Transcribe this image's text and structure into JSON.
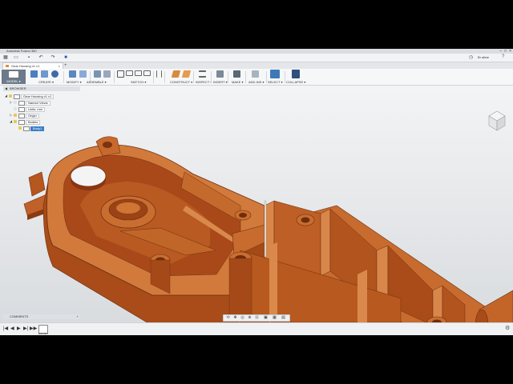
{
  "app": {
    "title": "Autodesk Fusion 360",
    "account": "Br attoe",
    "window_controls": [
      "–",
      "□",
      "×"
    ]
  },
  "qat": {
    "grid_icon": "grid-icon",
    "file_icon": "file-icon",
    "save_icon": "save-icon",
    "undo_icon": "undo-icon",
    "redo_icon": "redo-icon",
    "stop_icon": "stop-icon"
  },
  "document_tab": {
    "label": "Gear Housing v1 v1",
    "close": "×",
    "new_tab": "+"
  },
  "toolbar": {
    "workspace": "MODEL ▾",
    "groups": [
      {
        "label": "CREATE ▾"
      },
      {
        "label": "MODIFY ▾"
      },
      {
        "label": "ASSEMBLE ▾"
      },
      {
        "label": "SKETCH ▾"
      },
      {
        "label": "CONSTRUCT ▾"
      },
      {
        "label": "INSPECT ▾"
      },
      {
        "label": "INSERT ▾"
      },
      {
        "label": "MAKE ▾"
      },
      {
        "label": "ADD-INS ▾"
      },
      {
        "label": "SELECT ▾"
      },
      {
        "label": "COLLAPSE ▾"
      }
    ]
  },
  "browser": {
    "title": "BROWSER",
    "nodes": [
      {
        "label": "Gear Housing v1 v1",
        "icon": "component-icon"
      },
      {
        "label": "Named Views",
        "icon": "folder-icon"
      },
      {
        "label": "Units: mm",
        "icon": "document-icon"
      },
      {
        "label": "Origin",
        "icon": "folder-icon"
      },
      {
        "label": "Bodies",
        "icon": "folder-icon"
      },
      {
        "label": "Body1",
        "icon": "body-icon"
      }
    ]
  },
  "comments": {
    "label": "COMMENTS",
    "add": "+"
  },
  "navbar": {
    "icons": [
      "orbit-icon",
      "pan-icon",
      "look-at-icon",
      "zoom-icon",
      "fit-icon",
      "display-settings-icon",
      "grid-settings-icon",
      "viewports-icon"
    ]
  },
  "timeline": {
    "controls": [
      "|◀",
      "◀",
      "▶",
      "▶|",
      "▶▶"
    ],
    "feature_label": "Extrude1",
    "settings_icon": "gear-icon"
  },
  "colors": {
    "part": "#b9571e",
    "part_light": "#d8854a",
    "part_dark": "#7a330f",
    "selection": "#3a7ec7"
  }
}
